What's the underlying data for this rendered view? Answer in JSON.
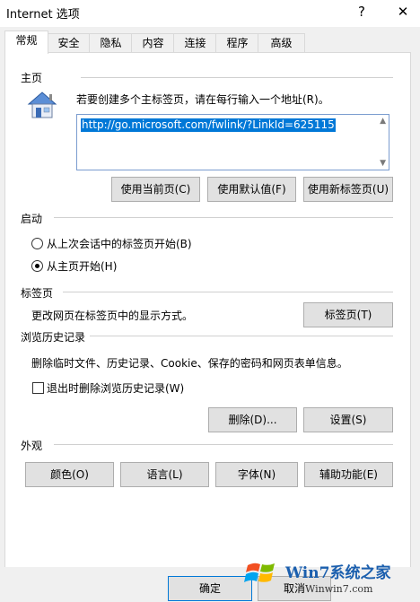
{
  "window": {
    "title": "Internet 选项",
    "help_label": "?",
    "close_label": "✕"
  },
  "tabs": [
    {
      "label": "常规"
    },
    {
      "label": "安全"
    },
    {
      "label": "隐私"
    },
    {
      "label": "内容"
    },
    {
      "label": "连接"
    },
    {
      "label": "程序"
    },
    {
      "label": "高级"
    }
  ],
  "home": {
    "title": "主页",
    "instruction": "若要创建多个主标签页，请在每行输入一个地址(R)。",
    "url": "http://go.microsoft.com/fwlink/?LinkId=625115",
    "buttons": {
      "current": "使用当前页(C)",
      "default": "使用默认值(F)",
      "newtab": "使用新标签页(U)"
    }
  },
  "startup": {
    "title": "启动",
    "option1": "从上次会话中的标签页开始(B)",
    "option2": "从主页开始(H)",
    "selected": "option2"
  },
  "tabs_section": {
    "title": "标签页",
    "desc": "更改网页在标签页中的显示方式。",
    "button": "标签页(T)"
  },
  "history": {
    "title": "浏览历史记录",
    "desc": "删除临时文件、历史记录、Cookie、保存的密码和网页表单信息。",
    "checkbox": "退出时删除浏览历史记录(W)",
    "checked": false,
    "delete_button": "删除(D)...",
    "settings_button": "设置(S)"
  },
  "appearance": {
    "title": "外观",
    "colors": "颜色(O)",
    "languages": "语言(L)",
    "fonts": "字体(N)",
    "accessibility": "辅助功能(E)"
  },
  "footer": {
    "ok": "确定",
    "cancel": "取消"
  },
  "watermark": {
    "brand": "Win7系统之家",
    "site": "Winwin7.com"
  }
}
